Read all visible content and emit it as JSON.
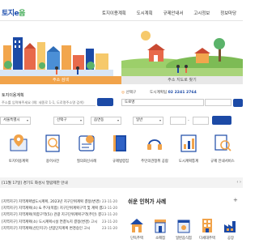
{
  "header": {
    "logo": {
      "prefix": "토지e",
      "suffix": "음"
    },
    "nav": [
      "토지이용계획",
      "도시계획",
      "규제안내서",
      "고시정보",
      "정보마당"
    ]
  },
  "hero": {
    "tab_left": "주소 검색",
    "tab_right": "주소 지도로 찾기"
  },
  "search": {
    "address_label": "토지이용계획",
    "address_placeholder": "주소를 입력해주세요 (예: 세종로 1-1, 도로명주소명 검색)",
    "zoom_label": "선택구",
    "zoom_icon": "◎",
    "phone_label": "도시계획팀",
    "phone_number": "02 2241 2764",
    "road_select": "도로명",
    "sido_select": "서울특별시",
    "sigungu_select": "선택구",
    "dong_select": "읍면동",
    "type_select": "일반",
    "bunji_dash": "-"
  },
  "quick_menu": [
    {
      "label": "토지이용계획",
      "icon": "map-pin-icon"
    },
    {
      "label": "용어사전",
      "icon": "dictionary-icon"
    },
    {
      "label": "질의회신사례",
      "icon": "qna-icon"
    },
    {
      "label": "규제법령집",
      "icon": "law-book-icon"
    },
    {
      "label": "주민의견청취 공람",
      "icon": "headset-icon"
    },
    {
      "label": "도시계획통계",
      "icon": "statistics-icon"
    },
    {
      "label": "규제 안내서비스",
      "icon": "guide-search-icon"
    }
  ],
  "notice": {
    "text": "[11월 17일] 경기도 화성시 열람제한 안내",
    "controls": "‹ ›"
  },
  "news": [
    {
      "title": "[지역지구] 지역계획법도시계획, 2023년 지구단위계획 결정(변경)",
      "date": "23-11-20"
    },
    {
      "title": "[지역지구] 지역계획(소) & 주거(복합) 지구단위계획구역 및 계획 결정",
      "date": "23-11-20"
    },
    {
      "title": "[지역지구] 지역계획(복합구역(5)) 관광 지구단위계획구역(주민) 결정",
      "date": "23-11-20"
    },
    {
      "title": "[지역지구] 지역계획(소) 도시계획시설 연결녹지 결정(변경) 고시",
      "date": "23-11-20"
    },
    {
      "title": "[지역지구] 지역계획(산단지구) 산업단지계획 변경승인 고시",
      "date": "23-11-20"
    }
  ],
  "easy": {
    "title": "쉬운 인허가 사례",
    "more": "+",
    "items": [
      {
        "label": "단독주택",
        "icon": "house-icon"
      },
      {
        "label": "소매점",
        "icon": "store-icon"
      },
      {
        "label": "일반음식점",
        "icon": "restaurant-icon"
      },
      {
        "label": "다세대주택",
        "icon": "multi-house-icon"
      },
      {
        "label": "공장",
        "icon": "factory-icon"
      }
    ]
  },
  "colors": {
    "primary": "#1c4aa6",
    "accent": "#f1a34a",
    "logo_blue": "#1e4fae",
    "logo_green": "#3aa74f"
  }
}
